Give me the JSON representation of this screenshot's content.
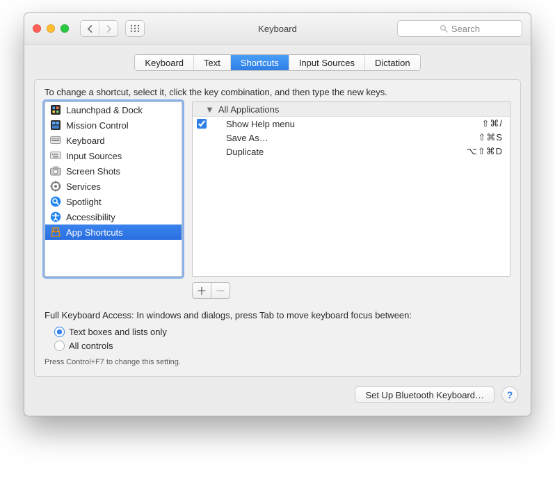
{
  "window": {
    "title": "Keyboard"
  },
  "toolbar": {
    "search_placeholder": "Search"
  },
  "tabs": [
    {
      "label": "Keyboard",
      "selected": false
    },
    {
      "label": "Text",
      "selected": false
    },
    {
      "label": "Shortcuts",
      "selected": true
    },
    {
      "label": "Input Sources",
      "selected": false
    },
    {
      "label": "Dictation",
      "selected": false
    }
  ],
  "instruction": "To change a shortcut, select it, click the key combination, and then type the new keys.",
  "categories": [
    {
      "label": "Launchpad & Dock",
      "icon": "launchpad",
      "selected": false
    },
    {
      "label": "Mission Control",
      "icon": "mission-control",
      "selected": false
    },
    {
      "label": "Keyboard",
      "icon": "keyboard",
      "selected": false
    },
    {
      "label": "Input Sources",
      "icon": "input-sources",
      "selected": false
    },
    {
      "label": "Screen Shots",
      "icon": "screen-shots",
      "selected": false
    },
    {
      "label": "Services",
      "icon": "services",
      "selected": false
    },
    {
      "label": "Spotlight",
      "icon": "spotlight",
      "selected": false
    },
    {
      "label": "Accessibility",
      "icon": "accessibility",
      "selected": false
    },
    {
      "label": "App Shortcuts",
      "icon": "app-shortcuts",
      "selected": true
    }
  ],
  "shortcut_group": {
    "header": "All Applications"
  },
  "shortcuts": [
    {
      "enabled": true,
      "label": "Show Help menu",
      "keys": "⇧⌘/"
    },
    {
      "enabled": null,
      "label": "Save As…",
      "keys": "⇧⌘S"
    },
    {
      "enabled": null,
      "label": "Duplicate",
      "keys": "⌥⇧⌘D"
    }
  ],
  "fka": {
    "label": "Full Keyboard Access: In windows and dialogs, press Tab to move keyboard focus between:",
    "options": [
      {
        "label": "Text boxes and lists only",
        "selected": true
      },
      {
        "label": "All controls",
        "selected": false
      }
    ],
    "hint": "Press Control+F7 to change this setting."
  },
  "footer": {
    "bluetooth_button": "Set Up Bluetooth Keyboard…",
    "help_symbol": "?"
  }
}
